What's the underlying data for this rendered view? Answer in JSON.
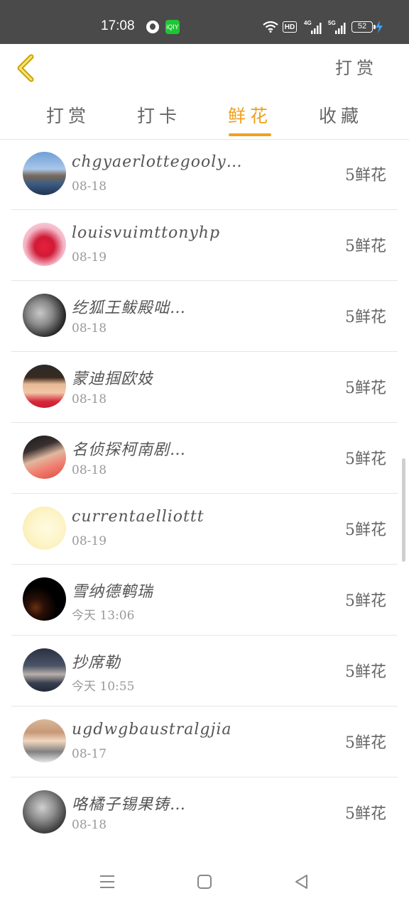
{
  "status_bar": {
    "time": "17:08",
    "hd_label": "HD",
    "sig1_label": "4G",
    "sig2_label": "5G",
    "battery": "52",
    "app2_label": "iQIY"
  },
  "nav": {
    "back_icon": "chevron-left-icon",
    "right_link": "打赏"
  },
  "tabs": [
    {
      "label": "打赏",
      "active": false
    },
    {
      "label": "打卡",
      "active": false
    },
    {
      "label": "鲜花",
      "active": true
    },
    {
      "label": "收藏",
      "active": false
    }
  ],
  "accent_color": "#f0a020",
  "rows": [
    {
      "name": "chgyaerlottegooly…",
      "date": "08-18",
      "amount": "5鲜花"
    },
    {
      "name": "louisvuimttonyhp",
      "date": "08-19",
      "amount": "5鲜花"
    },
    {
      "name": "纥狐王鲅殿咄…",
      "date": "08-18",
      "amount": "5鲜花"
    },
    {
      "name": "蒙迪掴欧妓",
      "date": "08-18",
      "amount": "5鲜花"
    },
    {
      "name": "名侦探柯南剧…",
      "date": "08-18",
      "amount": "5鲜花"
    },
    {
      "name": "currentaelliottt",
      "date": "08-19",
      "amount": "5鲜花"
    },
    {
      "name": "雪纳德鹌瑞",
      "date": "今天 13:06",
      "amount": "5鲜花"
    },
    {
      "name": "抄席勒",
      "date": "今天 10:55",
      "amount": "5鲜花"
    },
    {
      "name": "ugdwgbaustralgjia",
      "date": "08-17",
      "amount": "5鲜花"
    },
    {
      "name": "咯橘子锡果铸…",
      "date": "08-18",
      "amount": "5鲜花"
    }
  ],
  "system_nav": {
    "menu_icon": "menu-icon",
    "home_icon": "home-icon",
    "back_icon": "back-triangle-icon"
  }
}
